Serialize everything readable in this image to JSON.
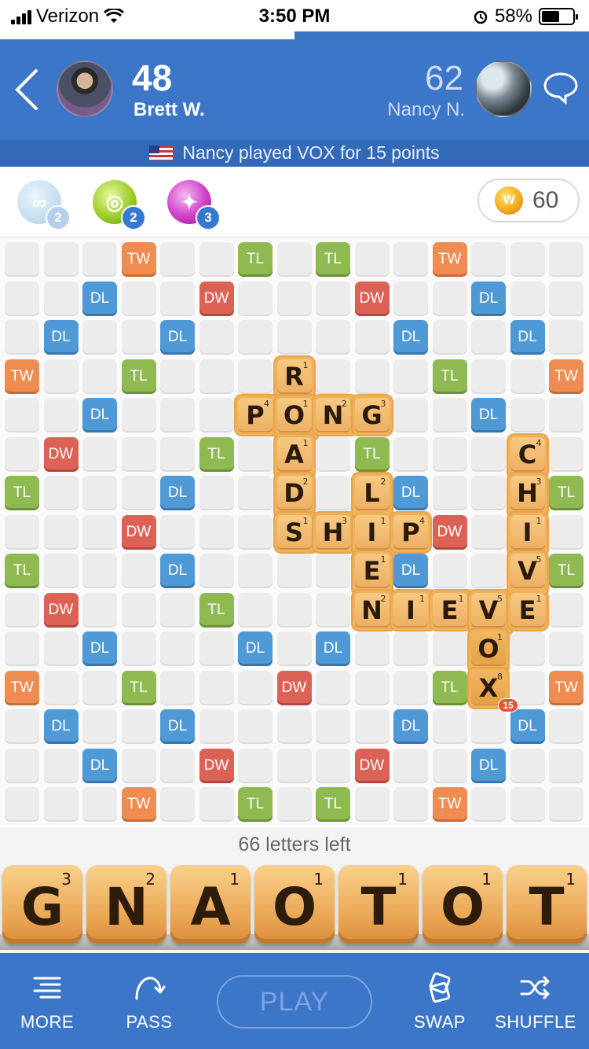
{
  "status": {
    "carrier": "Verizon",
    "time": "3:50 PM",
    "battery": "58%",
    "battery_level": 0.58,
    "icons": [
      "signal-icon",
      "wifi-icon",
      "alarm-icon",
      "battery-icon"
    ]
  },
  "load_progress": 0.5,
  "header": {
    "left_player": {
      "score": "48",
      "name": "Brett W."
    },
    "right_player": {
      "score": "62",
      "name": "Nancy N."
    },
    "last_play": "Nancy played VOX for 15 points",
    "colors": {
      "bar": "#3c76c9",
      "sub_bar": "#336ab8"
    }
  },
  "powerups": [
    {
      "name": "word-radar",
      "count": "2",
      "icon": "glasses-icon"
    },
    {
      "name": "hindsight",
      "count": "2",
      "icon": "target-icon"
    },
    {
      "name": "swap-plus",
      "count": "3",
      "icon": "sparkle-icon"
    }
  ],
  "coins": {
    "amount": "60",
    "icon_label": "W"
  },
  "board": {
    "size": 15,
    "bonus_rows": [
      "...TW..TL.TL..TW...",
      "..DL..DW...DW..DL..",
      ".DL..DL...DL..DL.",
      "TW..TL.......TL..TW",
      "..DL...........DL..",
      ".DW....TL...TL....",
      "TL...DL.......DL...TL",
      "...DW.........DW...",
      "TL...DL.......DL...TL",
      ".DW....TL...TL....",
      "..DL...DL.DL.......",
      "TW..TL...DW....TL..TW",
      ".DL..DL.......DL..DL.",
      "..DL..DW...DW..DL..",
      "...TW..TL.TL..TW..."
    ],
    "bonus_cells": [
      [
        0,
        3,
        "TW"
      ],
      [
        0,
        6,
        "TL"
      ],
      [
        0,
        8,
        "TL"
      ],
      [
        0,
        11,
        "TW"
      ],
      [
        1,
        2,
        "DL"
      ],
      [
        1,
        5,
        "DW"
      ],
      [
        1,
        9,
        "DW"
      ],
      [
        1,
        12,
        "DL"
      ],
      [
        2,
        1,
        "DL"
      ],
      [
        2,
        4,
        "DL"
      ],
      [
        2,
        10,
        "DL"
      ],
      [
        2,
        13,
        "DL"
      ],
      [
        3,
        0,
        "TW"
      ],
      [
        3,
        3,
        "TL"
      ],
      [
        3,
        11,
        "TL"
      ],
      [
        3,
        14,
        "TW"
      ],
      [
        4,
        2,
        "DL"
      ],
      [
        4,
        12,
        "DL"
      ],
      [
        5,
        1,
        "DW"
      ],
      [
        5,
        5,
        "TL"
      ],
      [
        5,
        9,
        "TL"
      ],
      [
        5,
        13,
        "DW"
      ],
      [
        6,
        0,
        "TL"
      ],
      [
        6,
        4,
        "DL"
      ],
      [
        6,
        10,
        "DL"
      ],
      [
        6,
        14,
        "TL"
      ],
      [
        7,
        3,
        "DW"
      ],
      [
        7,
        11,
        "DW"
      ],
      [
        8,
        0,
        "TL"
      ],
      [
        8,
        4,
        "DL"
      ],
      [
        8,
        10,
        "DL"
      ],
      [
        8,
        14,
        "TL"
      ],
      [
        9,
        1,
        "DW"
      ],
      [
        9,
        5,
        "TL"
      ],
      [
        9,
        9,
        "TL"
      ],
      [
        9,
        13,
        "DW"
      ],
      [
        10,
        2,
        "DL"
      ],
      [
        10,
        6,
        "DL"
      ],
      [
        10,
        8,
        "DL"
      ],
      [
        10,
        12,
        "DL"
      ],
      [
        11,
        0,
        "TW"
      ],
      [
        11,
        3,
        "TL"
      ],
      [
        11,
        7,
        "DW"
      ],
      [
        11,
        11,
        "TL"
      ],
      [
        11,
        14,
        "TW"
      ],
      [
        12,
        1,
        "DL"
      ],
      [
        12,
        4,
        "DL"
      ],
      [
        12,
        10,
        "DL"
      ],
      [
        12,
        13,
        "DL"
      ],
      [
        13,
        2,
        "DL"
      ],
      [
        13,
        5,
        "DW"
      ],
      [
        13,
        9,
        "DW"
      ],
      [
        13,
        12,
        "DL"
      ],
      [
        14,
        3,
        "TW"
      ],
      [
        14,
        6,
        "TL"
      ],
      [
        14,
        8,
        "TL"
      ],
      [
        14,
        11,
        "TW"
      ]
    ],
    "tiles": [
      [
        3,
        7,
        "R",
        "1"
      ],
      [
        4,
        6,
        "P",
        "4"
      ],
      [
        4,
        7,
        "O",
        "1"
      ],
      [
        4,
        8,
        "N",
        "2"
      ],
      [
        4,
        9,
        "G",
        "3"
      ],
      [
        5,
        7,
        "A",
        "1"
      ],
      [
        6,
        7,
        "D",
        "2"
      ],
      [
        7,
        7,
        "S",
        "1"
      ],
      [
        7,
        8,
        "H",
        "3"
      ],
      [
        7,
        9,
        "I",
        "1"
      ],
      [
        7,
        10,
        "P",
        "4"
      ],
      [
        6,
        9,
        "L",
        "2"
      ],
      [
        8,
        9,
        "E",
        "1"
      ],
      [
        9,
        9,
        "N",
        "2"
      ],
      [
        9,
        10,
        "I",
        "1"
      ],
      [
        9,
        11,
        "E",
        "1"
      ],
      [
        9,
        12,
        "V",
        "5"
      ],
      [
        9,
        13,
        "E",
        "1"
      ],
      [
        5,
        13,
        "C",
        "4"
      ],
      [
        6,
        13,
        "H",
        "3"
      ],
      [
        7,
        13,
        "I",
        "1"
      ],
      [
        8,
        13,
        "V",
        "5"
      ],
      [
        10,
        12,
        "O",
        "1"
      ],
      [
        11,
        12,
        "X",
        "8"
      ]
    ],
    "last_play_score": "15"
  },
  "letters_left": "66 letters left",
  "rack": [
    {
      "letter": "G",
      "points": "3"
    },
    {
      "letter": "N",
      "points": "2"
    },
    {
      "letter": "A",
      "points": "1"
    },
    {
      "letter": "O",
      "points": "1"
    },
    {
      "letter": "T",
      "points": "1"
    },
    {
      "letter": "O",
      "points": "1"
    },
    {
      "letter": "T",
      "points": "1"
    }
  ],
  "toolbar": {
    "more": "MORE",
    "pass": "PASS",
    "play": "PLAY",
    "swap": "SWAP",
    "shuffle": "SHUFFLE"
  }
}
